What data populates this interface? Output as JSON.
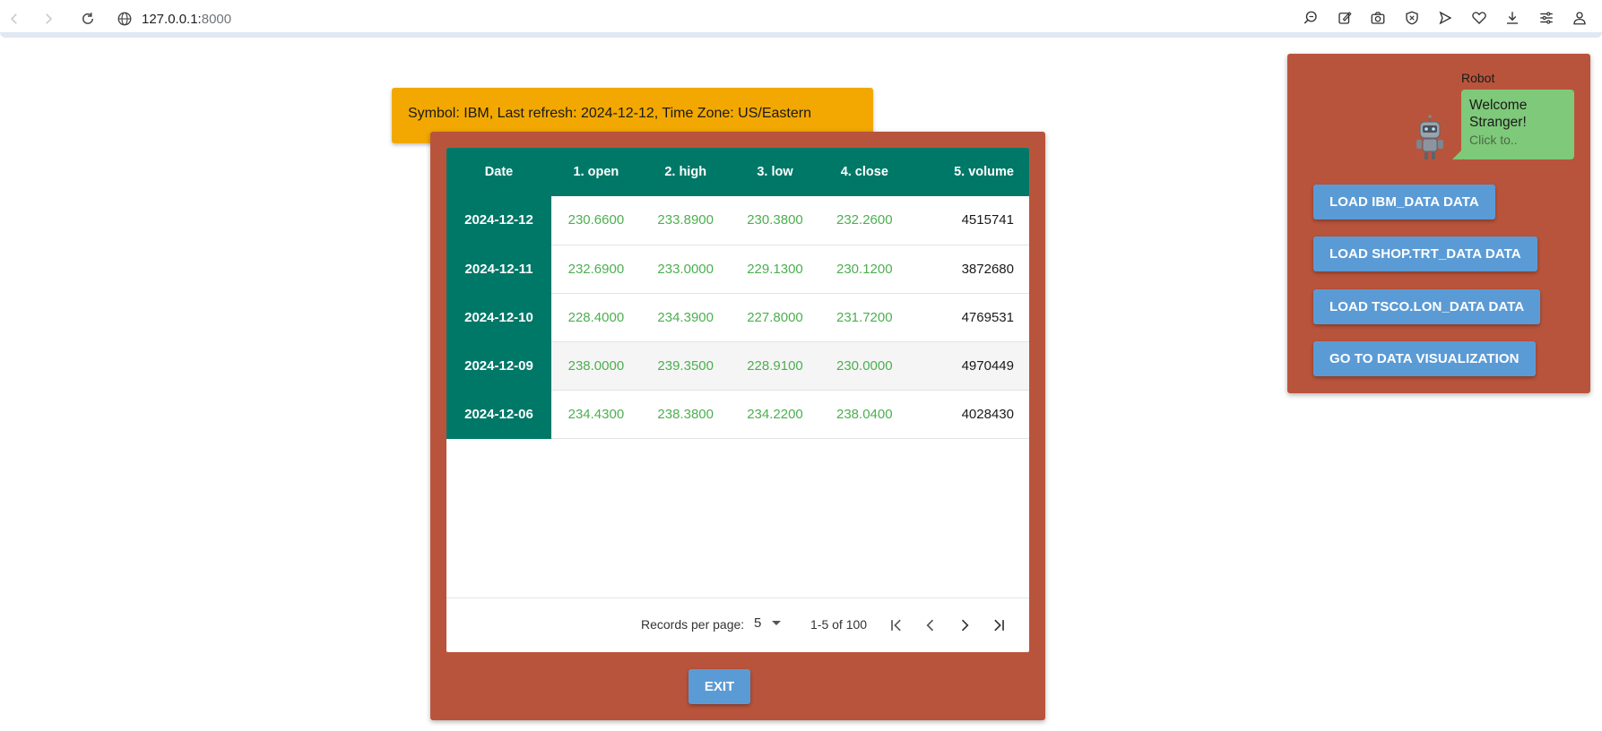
{
  "browser": {
    "url_host": "127.0.0.1:",
    "url_port": "8000"
  },
  "banner": {
    "text": "Symbol: IBM, Last refresh: 2024-12-12, Time Zone: US/Eastern"
  },
  "table": {
    "headers": [
      "Date",
      "1. open",
      "2. high",
      "3. low",
      "4. close",
      "5. volume"
    ],
    "rows": [
      {
        "date": "2024-12-12",
        "open": "230.6600",
        "high": "233.8900",
        "low": "230.3800",
        "close": "232.2600",
        "volume": "4515741"
      },
      {
        "date": "2024-12-11",
        "open": "232.6900",
        "high": "233.0000",
        "low": "229.1300",
        "close": "230.1200",
        "volume": "3872680"
      },
      {
        "date": "2024-12-10",
        "open": "228.4000",
        "high": "234.3900",
        "low": "227.8000",
        "close": "231.7200",
        "volume": "4769531"
      },
      {
        "date": "2024-12-09",
        "open": "238.0000",
        "high": "239.3500",
        "low": "228.9100",
        "close": "230.0000",
        "volume": "4970449"
      },
      {
        "date": "2024-12-06",
        "open": "234.4300",
        "high": "238.3800",
        "low": "234.2200",
        "close": "238.0400",
        "volume": "4028430"
      }
    ]
  },
  "pager": {
    "records_label": "Records per page:",
    "records_value": "5",
    "range": "1-5 of 100"
  },
  "main": {
    "exit_label": "EXIT"
  },
  "robot": {
    "name": "Robot",
    "greeting": "Welcome Stranger!",
    "hint": "Click to.."
  },
  "side_buttons": [
    {
      "label": "LOAD IBM_DATA DATA"
    },
    {
      "label": "LOAD SHOP.TRT_DATA DATA"
    },
    {
      "label": "LOAD TSCO.LON_DATA DATA"
    },
    {
      "label": "GO TO DATA VISUALIZATION"
    }
  ],
  "colors": {
    "panel": "#b9543c",
    "banner": "#f2a800",
    "header": "#007868",
    "button": "#5b9bd5",
    "value_text": "#4caf50",
    "bubble": "#7fc97a"
  }
}
